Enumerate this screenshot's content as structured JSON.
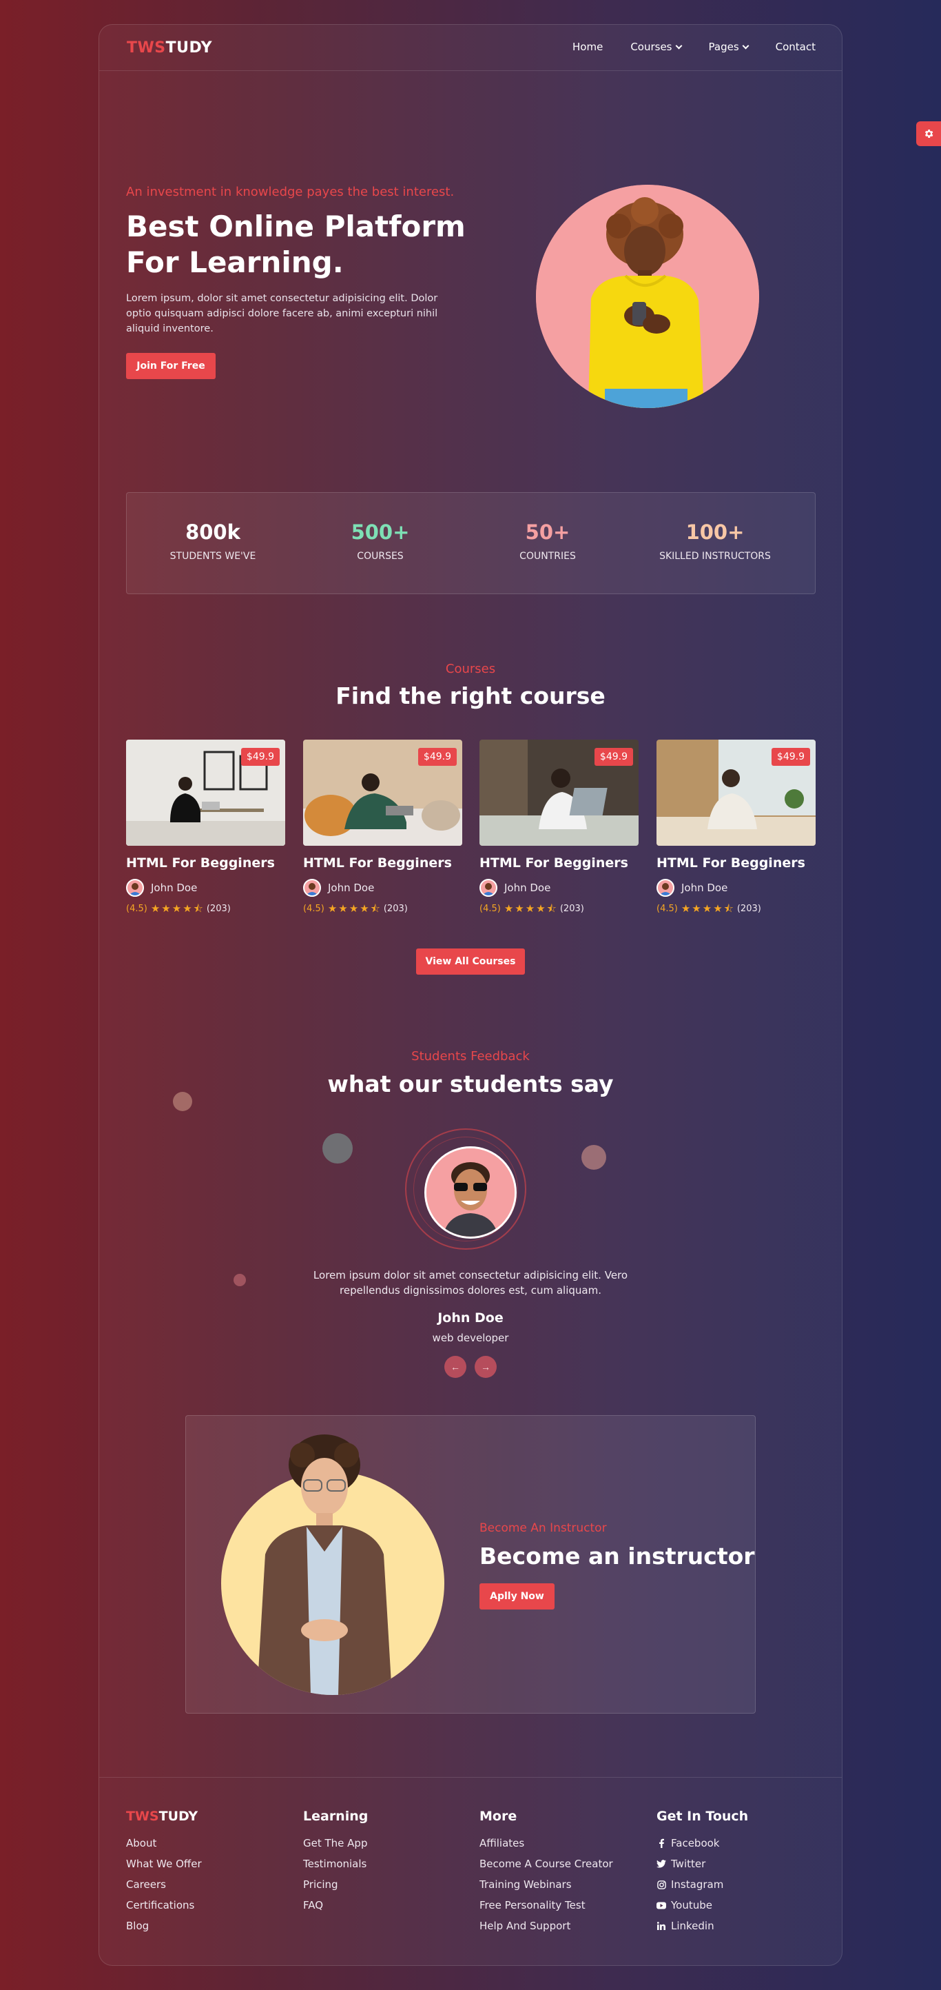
{
  "brand": {
    "logo_accent": "TWS",
    "logo_rest": "TUDY"
  },
  "nav": {
    "home": "Home",
    "courses": "Courses",
    "pages": "Pages",
    "contact": "Contact"
  },
  "hero": {
    "kicker": "An investment in knowledge payes the best interest.",
    "title": "Best Online Platform For Learning.",
    "text": "Lorem ipsum, dolor sit amet consectetur adipisicing elit. Dolor optio quisquam adipisci dolore facere ab, animi excepturi nihil aliquid inventore.",
    "button": "Join For Free"
  },
  "stats": [
    {
      "value": "800k",
      "label": "STUDENTS WE'VE",
      "color": "#ffffff"
    },
    {
      "value": "500+",
      "label": "COURSES",
      "color": "#7ee0b5"
    },
    {
      "value": "50+",
      "label": "COUNTRIES",
      "color": "#f5a0a2"
    },
    {
      "value": "100+",
      "label": "SKILLED INSTRUCTORS",
      "color": "#f8c7a6"
    }
  ],
  "courses": {
    "kicker": "Courses",
    "title": "Find the right course",
    "items": [
      {
        "price": "$49.9",
        "title": "HTML For Begginers",
        "instructor": "John Doe",
        "score": "(4.5)",
        "count": "(203)"
      },
      {
        "price": "$49.9",
        "title": "HTML For Begginers",
        "instructor": "John Doe",
        "score": "(4.5)",
        "count": "(203)"
      },
      {
        "price": "$49.9",
        "title": "HTML For Begginers",
        "instructor": "John Doe",
        "score": "(4.5)",
        "count": "(203)"
      },
      {
        "price": "$49.9",
        "title": "HTML For Begginers",
        "instructor": "John Doe",
        "score": "(4.5)",
        "count": "(203)"
      }
    ],
    "rating_value": 4.5,
    "view_all": "View All Courses"
  },
  "feedback": {
    "kicker": "Students Feedback",
    "title": "what our students say",
    "quote": "Lorem ipsum dolor sit amet consectetur adipisicing elit. Vero repellendus dignissimos dolores est, cum aliquam.",
    "name": "John Doe",
    "role": "web developer"
  },
  "instructor": {
    "kicker": "Become An Instructor",
    "title": "Become an instructor",
    "button": "Aplly Now"
  },
  "footer": {
    "learning_title": "Learning",
    "more_title": "More",
    "touch_title": "Get In Touch",
    "brand_links": [
      "About",
      "What We Offer",
      "Careers",
      "Certifications",
      "Blog"
    ],
    "learning_links": [
      "Get The App",
      "Testimonials",
      "Pricing",
      "FAQ"
    ],
    "more_links": [
      "Affiliates",
      "Become A Course Creator",
      "Training Webinars",
      "Free Personality Test",
      "Help And Support"
    ],
    "touch_links": [
      {
        "label": "Facebook",
        "icon": "facebook-icon"
      },
      {
        "label": "Twitter",
        "icon": "twitter-icon"
      },
      {
        "label": "Instagram",
        "icon": "instagram-icon"
      },
      {
        "label": "Youtube",
        "icon": "youtube-icon"
      },
      {
        "label": "Linkedin",
        "icon": "linkedin-icon"
      }
    ]
  },
  "colors": {
    "accent": "#e8474b",
    "star": "#f5a623"
  }
}
